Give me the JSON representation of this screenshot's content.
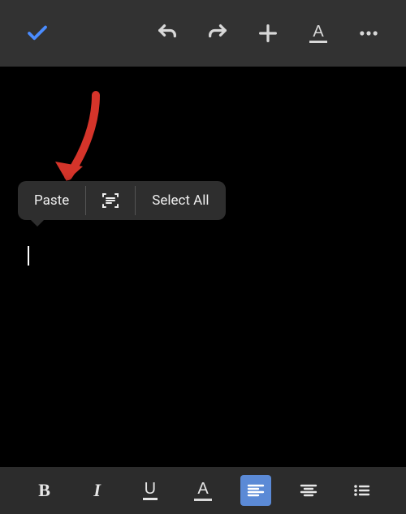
{
  "top_toolbar": {
    "confirm": "check",
    "undo": "undo",
    "redo": "redo",
    "insert": "plus",
    "text_format": "A",
    "more": "more"
  },
  "context_menu": {
    "paste_label": "Paste",
    "scan_text": "scan-text",
    "select_all_label": "Select All"
  },
  "bottom_toolbar": {
    "bold_label": "B",
    "italic_label": "I",
    "underline_label": "U",
    "text_color_label": "A",
    "align_left": "align-left",
    "align_center": "align-center",
    "bullet_list": "bullet-list"
  },
  "colors": {
    "accent_blue": "#4a8cff",
    "arrow_red": "#d5342a",
    "toolbar_bg": "#323232",
    "menu_bg": "#2e2e2e",
    "bottom_bg": "#2c2c2c",
    "active_btn": "#5b8ad6",
    "text_color_underline": "#d9d9d9"
  }
}
